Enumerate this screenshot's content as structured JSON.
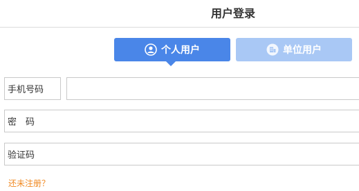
{
  "page": {
    "title": "用户登录"
  },
  "tabs": [
    {
      "label": "个人用户",
      "icon": "user-circle-icon",
      "active": true
    },
    {
      "label": "单位用户",
      "icon": "building-icon",
      "active": false
    }
  ],
  "form": {
    "phone_label": "手机号码",
    "password_label": "密　码",
    "captcha_label": "验证码"
  },
  "links": {
    "register": "还未注册？"
  },
  "colors": {
    "tab_active": "#4a86e8",
    "tab_inactive": "#a9c8f5",
    "register_link": "#f08a24"
  }
}
